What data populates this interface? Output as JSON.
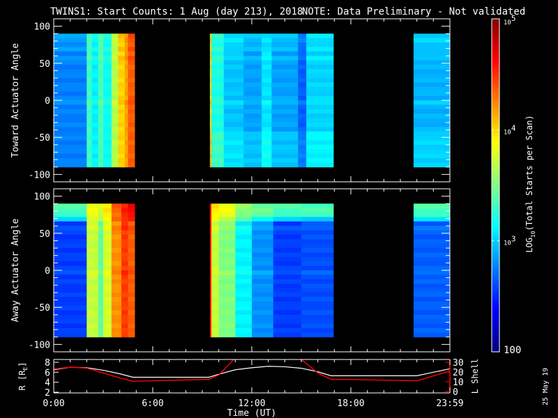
{
  "chart_data": {
    "type": "heatmap",
    "title": "TWINS1: Start Counts:  1 Aug (day 213), 2018",
    "note": "NOTE: Data Preliminary - Not validated",
    "note_color": "#ff0000",
    "xlabel": "Time (UT)",
    "xlim_hours": [
      0,
      24
    ],
    "xtick_hours": [
      0,
      6,
      12,
      18,
      24
    ],
    "xtick_labels": [
      "0:00",
      "6:00",
      "12:00",
      "18:00",
      "23:59"
    ],
    "date_stamp": "25 May 19",
    "panels": [
      {
        "ylabel": "Toward Actuator Angle",
        "ylim": [
          -110,
          110
        ],
        "data_angle_range": [
          -90,
          90
        ],
        "yticks": [
          -100,
          -50,
          0,
          50,
          100
        ],
        "ytick_labels": [
          "-100",
          "-50",
          "0",
          "50",
          "100"
        ],
        "bands_hours_log10_toplog10": [
          [
            0.0,
            2.0,
            2.75,
            2.8
          ],
          [
            2.0,
            2.3,
            3.3,
            3.3
          ],
          [
            2.3,
            2.7,
            3.1,
            3.1
          ],
          [
            2.7,
            3.0,
            3.35,
            3.35
          ],
          [
            3.0,
            3.5,
            3.15,
            3.15
          ],
          [
            3.5,
            3.9,
            3.65,
            3.65
          ],
          [
            3.9,
            4.3,
            4.0,
            4.0
          ],
          [
            4.3,
            4.5,
            4.15,
            4.15
          ],
          [
            4.5,
            4.9,
            4.35,
            4.35
          ],
          [
            9.46,
            9.55,
            4.0,
            4.0
          ],
          [
            9.55,
            10.3,
            3.2,
            3.2
          ],
          [
            10.3,
            11.5,
            2.95,
            3.0
          ],
          [
            11.5,
            12.6,
            2.85,
            2.9
          ],
          [
            12.6,
            13.2,
            3.05,
            3.0
          ],
          [
            13.2,
            14.8,
            2.85,
            2.9
          ],
          [
            14.8,
            15.3,
            2.65,
            2.7
          ],
          [
            15.3,
            16.94,
            3.0,
            3.0
          ],
          [
            21.8,
            24.0,
            2.9,
            2.95
          ]
        ]
      },
      {
        "ylabel": "Away Actuator Angle",
        "ylim": [
          -110,
          110
        ],
        "data_angle_range": [
          -90,
          90
        ],
        "yticks": [
          -100,
          -50,
          0,
          50,
          100
        ],
        "ytick_labels": [
          "-100",
          "-50",
          "0",
          "50",
          "100"
        ],
        "bands_hours_log10_toplog10": [
          [
            0.0,
            2.0,
            2.55,
            3.3
          ],
          [
            2.0,
            2.7,
            3.7,
            3.8
          ],
          [
            2.7,
            3.0,
            3.4,
            3.7
          ],
          [
            3.0,
            3.5,
            3.75,
            3.9
          ],
          [
            3.5,
            4.1,
            4.2,
            4.3
          ],
          [
            4.1,
            4.5,
            4.45,
            4.5
          ],
          [
            4.5,
            4.9,
            4.35,
            4.6
          ],
          [
            9.46,
            9.55,
            4.6,
            4.6
          ],
          [
            9.55,
            10.0,
            3.7,
            3.9
          ],
          [
            10.0,
            11.0,
            3.5,
            3.8
          ],
          [
            11.0,
            12.0,
            3.1,
            3.5
          ],
          [
            12.0,
            13.3,
            2.8,
            3.4
          ],
          [
            13.3,
            15.0,
            2.55,
            3.3
          ],
          [
            15.0,
            16.94,
            2.6,
            3.3
          ],
          [
            21.8,
            24.0,
            2.65,
            3.3
          ]
        ]
      }
    ],
    "colorbar": {
      "scale": "log10",
      "range_log10": [
        2,
        5
      ],
      "ticks": [
        {
          "log10": 5,
          "base": "10",
          "exp": "5"
        },
        {
          "log10": 4,
          "base": "10",
          "exp": "4"
        },
        {
          "log10": 3,
          "base": "10",
          "exp": "3"
        },
        {
          "log10": 2,
          "base": "100",
          "exp": ""
        }
      ],
      "label_prefix": "LOG",
      "label_sub": "10",
      "label_suffix": "(Total Starts per Scan)"
    },
    "orbit": {
      "left_label_prefix": "R [R",
      "left_label_sub": "E",
      "left_label_suffix": "]",
      "left_yticks": [
        2,
        4,
        6,
        8
      ],
      "left_color": "#ffffff",
      "right_label": "L Shell",
      "right_yticks": [
        0,
        10,
        20,
        30
      ],
      "right_color": "#ff0000",
      "R": {
        "hours": [
          0,
          1,
          2,
          3,
          4,
          4.8,
          9.4,
          10,
          11,
          12,
          13,
          14,
          15,
          16,
          16.8,
          22,
          23,
          24
        ],
        "values": [
          6.5,
          7.0,
          6.9,
          6.4,
          5.7,
          5.0,
          5.0,
          5.6,
          6.5,
          6.9,
          7.2,
          7.1,
          6.8,
          6.1,
          5.3,
          5.3,
          6.0,
          6.7
        ]
      },
      "L": {
        "hours": [
          0,
          1,
          2,
          3,
          4,
          4.8,
          6,
          9.4,
          10,
          11.3,
          14.5,
          16,
          16.8,
          19,
          22,
          24
        ],
        "values": [
          23,
          25,
          24,
          19,
          14,
          10.5,
          11,
          12.5,
          17,
          40,
          40,
          19,
          12.5,
          12,
          11,
          21
        ]
      }
    }
  }
}
